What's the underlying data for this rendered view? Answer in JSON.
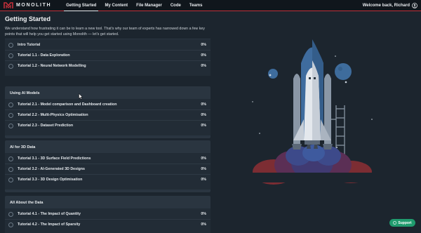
{
  "brand": {
    "name": "MONOLITH",
    "accent": "#c2303a"
  },
  "nav": [
    {
      "label": "Getting Started",
      "active": true
    },
    {
      "label": "My Content"
    },
    {
      "label": "File Manager"
    },
    {
      "label": "Code"
    },
    {
      "label": "Teams"
    }
  ],
  "header": {
    "welcome": "Welcome back, Richard",
    "user_icon": "user-circle-icon"
  },
  "page": {
    "title": "Getting Started",
    "intro": "We understand how frustrating it can be to learn a new tool. That's why our team of experts has narrowed down a few key points that will help you get started using Monolith — let's get started."
  },
  "sections": [
    {
      "title": "",
      "items": [
        {
          "label": "Intro Tutorial",
          "progress": "0%"
        },
        {
          "label": "Tutorial 1.1 - Data Exploration",
          "progress": "0%"
        },
        {
          "label": "Tutorial 1.2 - Neural Network Modelling",
          "progress": "0%"
        }
      ]
    },
    {
      "title": "Using AI Models",
      "items": [
        {
          "label": "Tutorial 2.1 - Model comparison and Dashboard creation",
          "progress": "0%"
        },
        {
          "label": "Tutorial 2.2 - Multi-Physics Optimisation",
          "progress": "0%"
        },
        {
          "label": "Tutorial 2.3 - Dataset Prediction",
          "progress": "0%"
        }
      ]
    },
    {
      "title": "AI for 3D Data",
      "items": [
        {
          "label": "Tutorial 3.1 - 3D Surface Field Predictions",
          "progress": "0%"
        },
        {
          "label": "Tutorial 3.2 - AI-Generated 3D Designs",
          "progress": "0%"
        },
        {
          "label": "Tutorial 3.3 - 3D Design Optimisation",
          "progress": "0%"
        }
      ]
    },
    {
      "title": "All About the Data",
      "items": [
        {
          "label": "Tutorial 4.1 - The Impact of Quantity",
          "progress": "0%"
        },
        {
          "label": "Tutorial 4.2 - The Impact of Sparsity",
          "progress": "0%"
        }
      ]
    }
  ],
  "support": {
    "label": "Support",
    "icon": "help-circle-icon"
  },
  "illustration": {
    "name": "rocket-launch-illustration"
  }
}
